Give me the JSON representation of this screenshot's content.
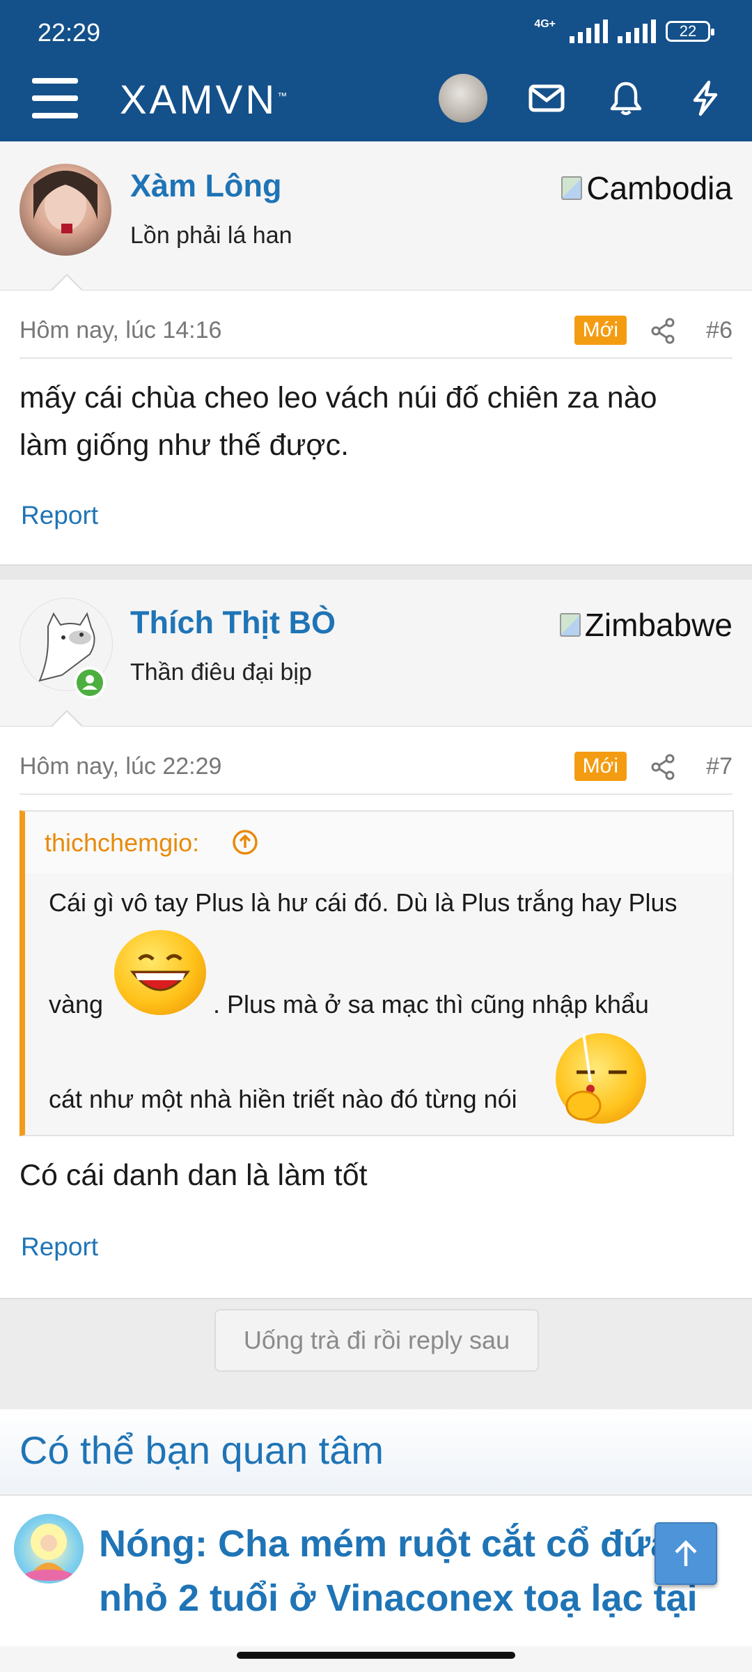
{
  "status_bar": {
    "time": "22:29",
    "network": "4G+",
    "battery": "22"
  },
  "navbar": {
    "logo": "XAMVN",
    "logo_mark": "™"
  },
  "posts": [
    {
      "username": "Xàm Lông",
      "user_title": "Lồn phải lá han",
      "country": "Cambodia",
      "date": "Hôm nay, lúc 14:16",
      "badge": "Mới",
      "number": "#6",
      "content_line1": "mấy cái chùa cheo leo vách núi đố chiên za nào",
      "content_line2": "làm giống như thế được.",
      "report": "Report"
    },
    {
      "username": "Thích Thịt BÒ",
      "user_title": "Thần điêu đại bịp",
      "country": "Zimbabwe",
      "date": "Hôm nay, lúc 22:29",
      "badge": "Mới",
      "number": "#7",
      "quote": {
        "author": "thichchemgio:",
        "line1": "Cái gì vô tay Plus là hư cái đó. Dù là Plus trắng hay Plus",
        "line2a": "vàng",
        "line2b": ". Plus mà ở sa mạc thì cũng nhập khẩu",
        "line3": "cát như một nhà hiền triết nào đó từng nói"
      },
      "content_line1": "Có cái danh dan là làm tốt",
      "report": "Report"
    }
  ],
  "reply_button": "Uống trà đi rồi reply sau",
  "suggestions": {
    "title": "Có thể bạn quan tâm",
    "item_line1": "Nóng: Cha mém ruột cắt cổ đứa",
    "item_line2": "nhỏ 2 tuổi ở Vinaconex toạ lạc tại"
  },
  "colors": {
    "header": "#14508a",
    "link": "#1f74b6",
    "badge": "#f39c12",
    "quote_border": "#f29a1a"
  }
}
